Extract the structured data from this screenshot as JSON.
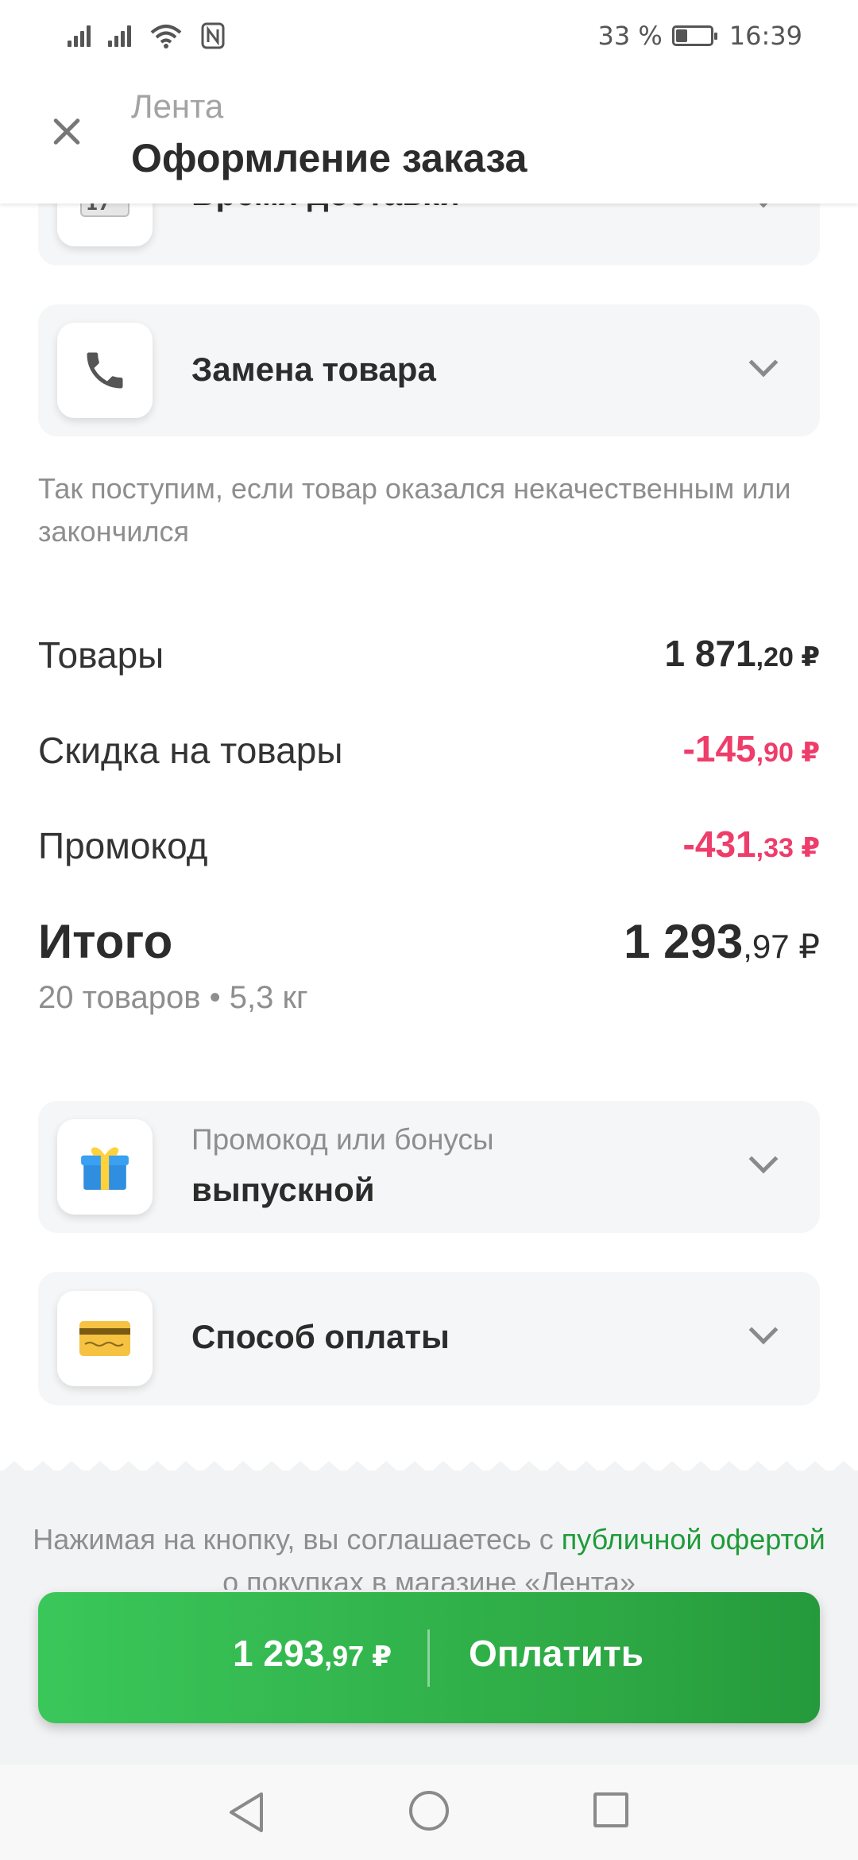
{
  "status": {
    "battery": "33 %",
    "time": "16:39",
    "battery_level": 0.33
  },
  "header": {
    "subtitle": "Лента",
    "title": "Оформление заказа"
  },
  "cards": {
    "delivery_time": {
      "label": "Время доставки",
      "icon": "calendar-icon",
      "icon_text": "17"
    },
    "replacement": {
      "label": "Замена товара",
      "icon": "phone-icon"
    },
    "promo": {
      "label": "Промокод или бонусы",
      "value": "выпускной",
      "icon": "gift-icon"
    },
    "payment": {
      "label": "Способ оплаты",
      "icon": "credit-card-icon"
    }
  },
  "replacement_hint": "Так поступим, если товар оказался некачественным или закончился",
  "summary": {
    "goods": {
      "label": "Товары",
      "rub": "1 871",
      "kop": ",20 ₽"
    },
    "discount": {
      "label": "Скидка на товары",
      "rub": "-145",
      "kop": ",90 ₽"
    },
    "promocode": {
      "label": "Промокод",
      "rub": "-431",
      "kop": ",33 ₽"
    },
    "total": {
      "label": "Итого",
      "rub": "1 293",
      "kop": ",97 ₽",
      "meta": "20 товаров • 5,3 кг"
    }
  },
  "agreement": {
    "text_before": "Нажимая на кнопку, вы соглашаетесь с ",
    "link": "публичной офертой",
    "text_after": " о покупках в магазине «Лента»"
  },
  "pay_button": {
    "amount_rub": "1 293",
    "amount_kop": ",97 ₽",
    "label": "Оплатить"
  },
  "colors": {
    "accent_green": "#2eaa45",
    "negative": "#ef3d6b",
    "card_bg": "#f5f6f7"
  }
}
